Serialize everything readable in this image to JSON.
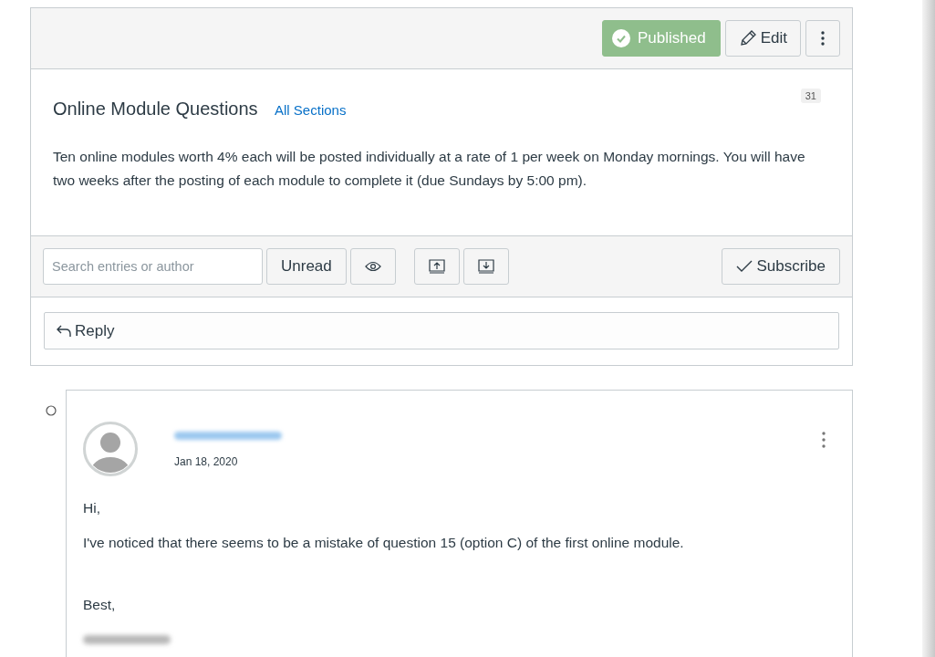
{
  "header": {
    "publish_button": {
      "label": "Published",
      "published": true
    },
    "edit_button": "Edit"
  },
  "topic": {
    "title": "Online Module Questions",
    "count": "31",
    "sections_link": "All Sections",
    "message": "Ten online modules worth 4% each will be posted individually at a rate of 1 per week on Monday mornings. You will have two weeks after the posting of each module to complete it (due Sundays by 5:00 pm)."
  },
  "toolbar": {
    "search": {
      "placeholder": "Search entries or author"
    },
    "unread_button": "Unread",
    "subscribe_button": "Subscribe"
  },
  "reply_button": "Reply",
  "entry": {
    "date": "Jan 18, 2020",
    "paragraphs": [
      "Hi,",
      "I've noticed that there seems to be a mistake of question 15 (option C) of the first online module.",
      "Best,"
    ]
  }
}
